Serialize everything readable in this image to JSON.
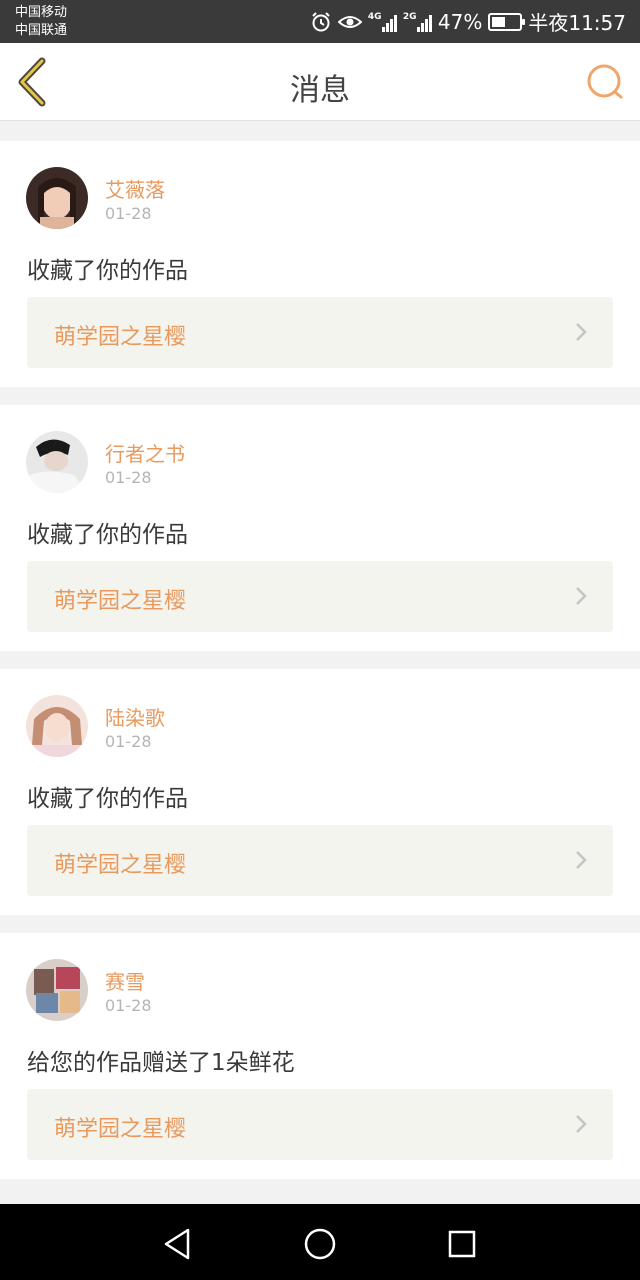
{
  "status_bar": {
    "carrier_1": "中国移动",
    "carrier_2": "中国联通",
    "network_1": "4G",
    "network_2": "2G",
    "battery_percent": "47%",
    "battery_level": 0.47,
    "time": "半夜11:57",
    "icons": [
      "alarm-icon",
      "eye-icon",
      "signal-icon",
      "signal-icon",
      "battery-icon"
    ]
  },
  "header": {
    "title": "消息",
    "back_icon": "chevron-left-icon",
    "search_icon": "search-icon",
    "accent_color": "#e89a5e"
  },
  "messages": [
    {
      "username": "艾薇落",
      "date": "01-28",
      "text": "收藏了你的作品",
      "work_title": "萌学园之星樱"
    },
    {
      "username": "行者之书",
      "date": "01-28",
      "text": "收藏了你的作品",
      "work_title": "萌学园之星樱"
    },
    {
      "username": "陆染歌",
      "date": "01-28",
      "text": "收藏了你的作品",
      "work_title": "萌学园之星樱"
    },
    {
      "username": "赛雪",
      "date": "01-28",
      "text": "给您的作品赠送了1朵鲜花",
      "work_title": "萌学园之星樱"
    }
  ],
  "nav_bar": {
    "icons": [
      "back-triangle-icon",
      "home-circle-icon",
      "recents-square-icon"
    ]
  }
}
